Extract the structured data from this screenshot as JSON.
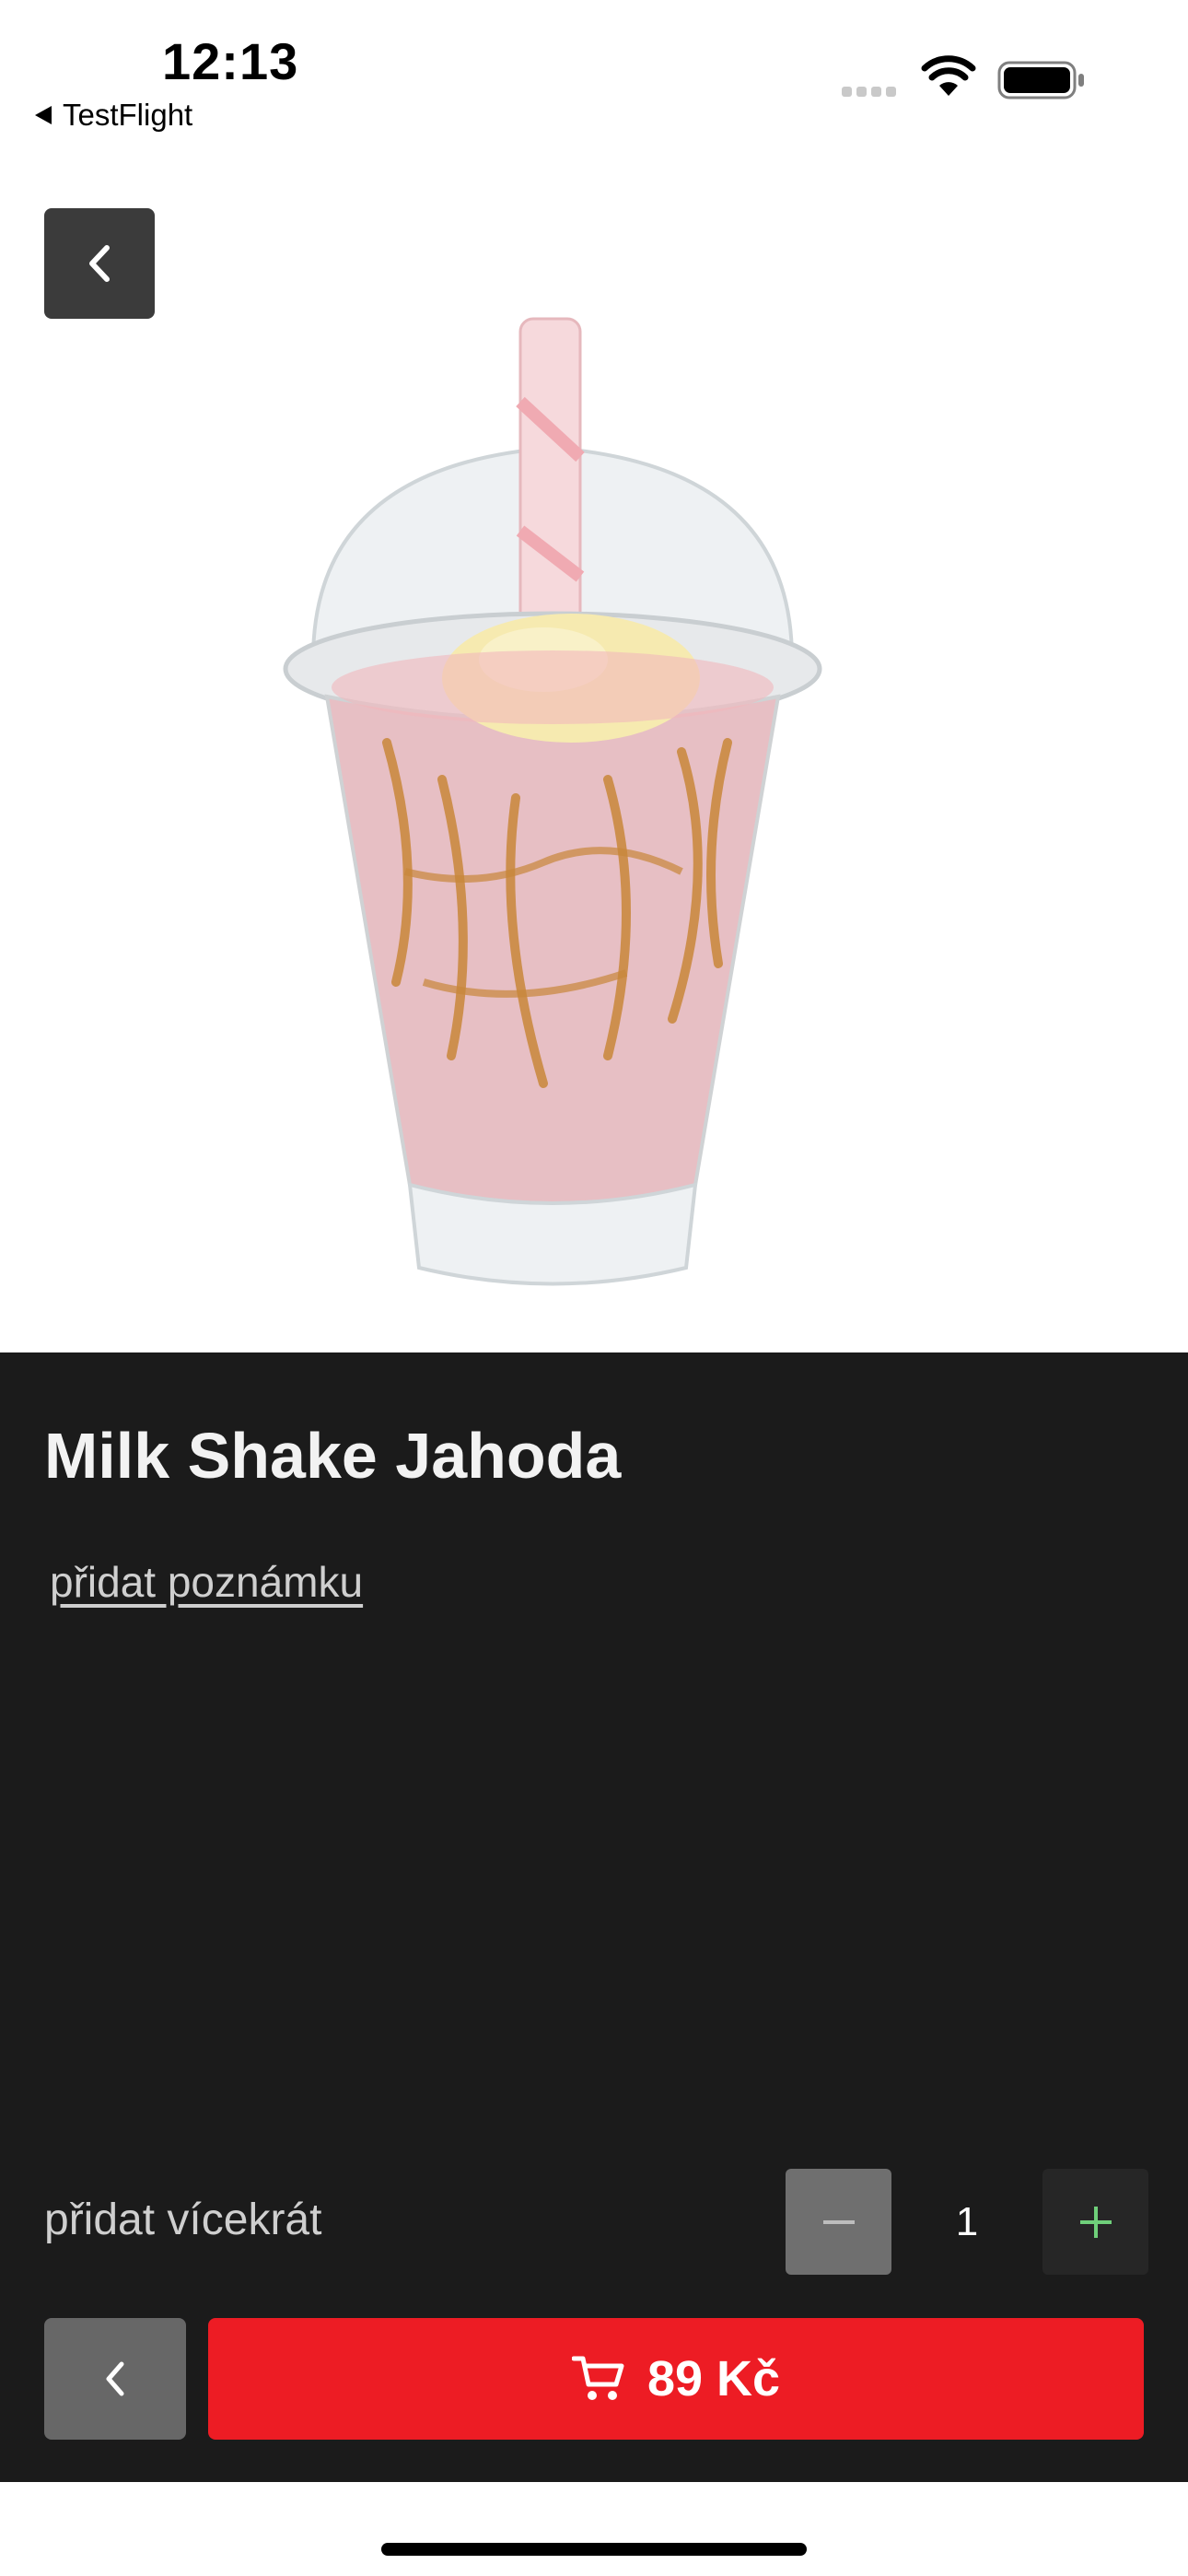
{
  "status_bar": {
    "time": "12:13",
    "back_app": "TestFlight",
    "icons": [
      "cellular-signal-icon",
      "wifi-icon",
      "battery-icon"
    ]
  },
  "hero": {
    "back_icon": "chevron-left-icon",
    "image": "milkshake-photo"
  },
  "product": {
    "title": "Milk Shake Jahoda",
    "note_link": "přidat poznámku"
  },
  "quantity": {
    "label": "přidat vícekrát",
    "value": "1",
    "minus_icon": "minus-icon",
    "plus_icon": "plus-icon"
  },
  "actions": {
    "back_icon": "chevron-left-icon",
    "cart_icon": "cart-icon",
    "price": "89 Kč"
  },
  "colors": {
    "accent": "#ed1c24",
    "background": "#1b1b1b",
    "plus_icon": "#6fcf7a"
  }
}
